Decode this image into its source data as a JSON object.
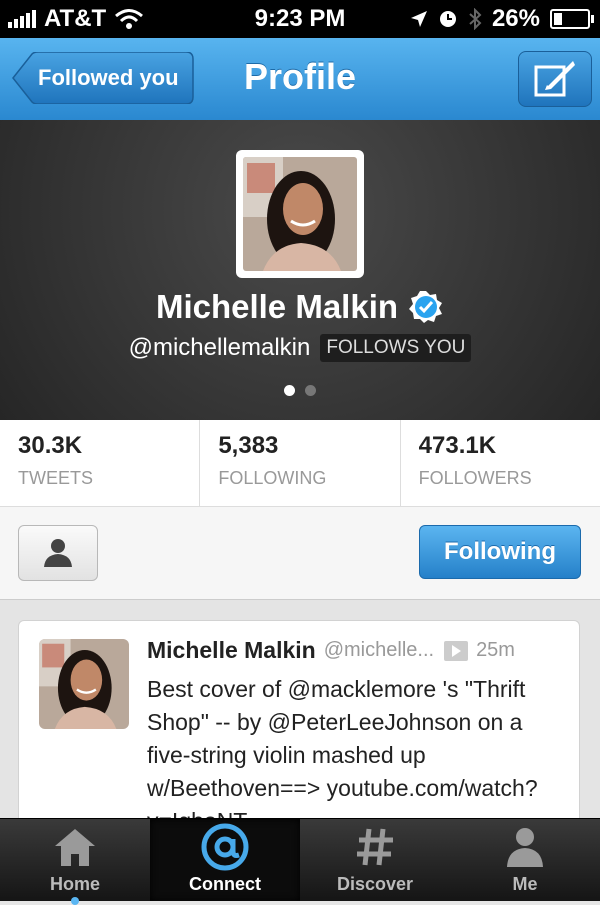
{
  "status_bar": {
    "carrier": "AT&T",
    "time": "9:23 PM",
    "battery": "26%",
    "battery_level": 0.26
  },
  "nav": {
    "back_label": "Followed you",
    "title": "Profile",
    "compose_icon": "compose-icon"
  },
  "profile": {
    "name": "Michelle Malkin",
    "handle": "@michellemalkin",
    "follows_you": "FOLLOWS YOU",
    "verified": true
  },
  "stats": [
    {
      "value": "30.3K",
      "label": "TWEETS"
    },
    {
      "value": "5,383",
      "label": "FOLLOWING"
    },
    {
      "value": "473.1K",
      "label": "FOLLOWERS"
    }
  ],
  "actions": {
    "following_label": "Following"
  },
  "tweet": {
    "author": "Michelle Malkin",
    "username": "@michelle...",
    "time": "25m",
    "text": "Best cover of @macklemore 's \"Thrift Shop\" -- by @PeterLeeJohnson on a five-string violin mashed up w/Beethoven==> youtube.com/watch?v=IqboNT"
  },
  "tabs": [
    {
      "label": "Home",
      "icon": "home-icon"
    },
    {
      "label": "Connect",
      "icon": "at-icon"
    },
    {
      "label": "Discover",
      "icon": "hash-icon"
    },
    {
      "label": "Me",
      "icon": "person-icon"
    }
  ],
  "colors": {
    "accent": "#2a88d0",
    "verified": "#1da1f2"
  }
}
